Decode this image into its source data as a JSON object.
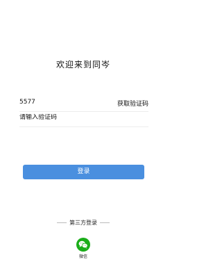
{
  "header": {
    "title": "欢迎来到同岑"
  },
  "form": {
    "phone_value": "5577",
    "get_code_label": "获取验证码",
    "code_placeholder": "请输入验证码"
  },
  "actions": {
    "login_label": "登录"
  },
  "third_party": {
    "label": "第三方登录",
    "wechat_label": "微信",
    "wechat_icon": "wechat-icon"
  },
  "colors": {
    "primary": "#4a8fdf",
    "wechat": "#1aad19"
  }
}
